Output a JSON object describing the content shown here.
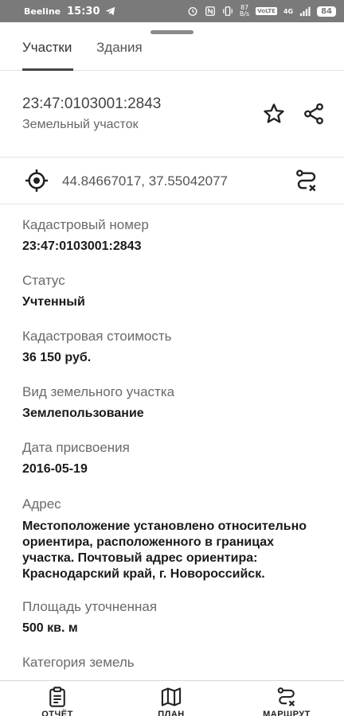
{
  "status_bar": {
    "carrier": "Beeline",
    "time": "15:30",
    "net_speed_value": "87",
    "net_speed_unit": "B/s",
    "volte": "VoLTE",
    "network": "4G",
    "battery": "84"
  },
  "tabs": [
    {
      "label": "Участки",
      "active": true
    },
    {
      "label": "Здания",
      "active": false
    }
  ],
  "header": {
    "cadastral_number": "23:47:0103001:2843",
    "object_type": "Земельный участок"
  },
  "location": {
    "coordinates": "44.84667017, 37.55042077"
  },
  "properties": [
    {
      "label": "Кадастровый номер",
      "value": "23:47:0103001:2843"
    },
    {
      "label": "Статус",
      "value": "Учтенный"
    },
    {
      "label": "Кадастровая стоимость",
      "value": "36 150 руб."
    },
    {
      "label": "Вид земельного участка",
      "value": "Землепользование"
    },
    {
      "label": "Дата присвоения",
      "value": "2016-05-19"
    },
    {
      "label": "Адрес",
      "value_lines": [
        "Местоположение установлено относительно",
        "ориентира, расположенного в границах",
        "участка. Почтовый адрес ориентира:",
        "Краснодарский край, г. Новороссийск."
      ]
    },
    {
      "label": "Площадь уточненная",
      "value": "500 кв. м"
    },
    {
      "label": "Категория земель"
    }
  ],
  "bottom_nav": [
    {
      "label": "ОТЧЁТ",
      "icon": "report-clipboard-icon"
    },
    {
      "label": "ПЛАН",
      "icon": "map-plan-icon"
    },
    {
      "label": "МАРШРУТ",
      "icon": "route-icon"
    }
  ],
  "colors": {
    "status_bar_bg": "#7a7a7a",
    "text_primary": "#1a1a1a",
    "text_secondary": "#6a6a6a",
    "divider": "#e4e4e4"
  }
}
